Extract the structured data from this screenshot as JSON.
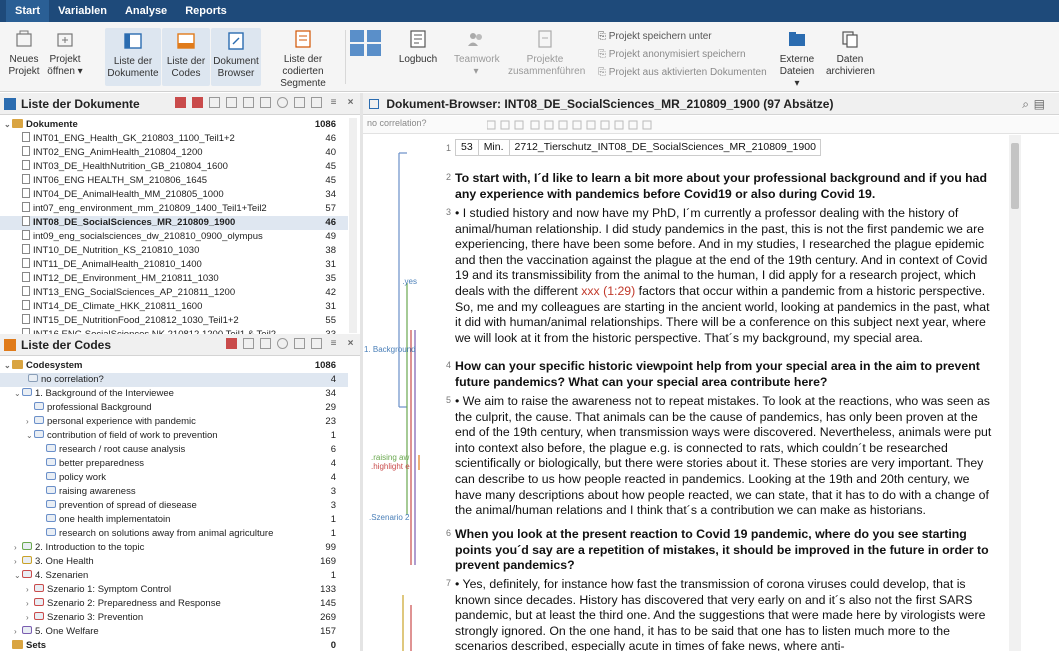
{
  "menu": [
    "Start",
    "Variablen",
    "Analyse",
    "Reports"
  ],
  "ribbon": {
    "buttons": [
      {
        "label": "Neues\nProjekt"
      },
      {
        "label": "Projekt\nöffnen ▾"
      },
      {
        "label": "Liste der\nDokumente"
      },
      {
        "label": "Liste der\nCodes"
      },
      {
        "label": "Dokument\nBrowser"
      },
      {
        "label": "Liste der codierten\nSegmente"
      },
      {
        "label": "Logbuch"
      },
      {
        "label": "Teamwork\n▾"
      },
      {
        "label": "Projekte\nzusammenführen"
      },
      {
        "label": "Externe\nDateien ▾"
      },
      {
        "label": "Daten\narchivieren"
      }
    ],
    "small_items": [
      "Projekt speichern unter",
      "Projekt anonymisiert speichern",
      "Projekt aus aktivierten Dokumenten"
    ]
  },
  "documents": {
    "title": "Liste der Dokumente",
    "root": {
      "label": "Dokumente",
      "count": "1086"
    },
    "items": [
      {
        "label": "INT01_ENG_Health_GK_210803_1100_Teil1+2",
        "count": "46"
      },
      {
        "label": "INT02_ENG_AnimHealth_210804_1200",
        "count": "40"
      },
      {
        "label": "INT03_DE_HealthNutrition_GB_210804_1600",
        "count": "45"
      },
      {
        "label": "INT06_ENG HEALTH_SM_210806_1645",
        "count": "45"
      },
      {
        "label": "INT04_DE_AnimalHealth_MM_210805_1000",
        "count": "34"
      },
      {
        "label": "int07_eng_environment_mm_210809_1400_Teil1+Teil2",
        "count": "57"
      },
      {
        "label": "INT08_DE_SocialSciences_MR_210809_1900",
        "count": "46"
      },
      {
        "label": "int09_eng_socialsciences_dw_210810_0900_olympus",
        "count": "49"
      },
      {
        "label": "INT10_DE_Nutrition_KS_210810_1030",
        "count": "38"
      },
      {
        "label": "INT11_DE_AnimalHealth_210810_1400",
        "count": "31"
      },
      {
        "label": "INT12_DE_Environment_HM_210811_1030",
        "count": "35"
      },
      {
        "label": "INT13_ENG_SocialSciences_AP_210811_1200",
        "count": "42"
      },
      {
        "label": "INT14_DE_Climate_HKK_210811_1600",
        "count": "31"
      },
      {
        "label": "INT15_DE_NutritionFood_210812_1030_Teil1+2",
        "count": "55"
      },
      {
        "label": "INT16 ENG SocialSciences NK 210812 1200 Teil1 & Teil2",
        "count": "33"
      }
    ]
  },
  "codes": {
    "title": "Liste der Codes",
    "root": {
      "label": "Codesystem",
      "count": "1086"
    },
    "items": [
      {
        "label": "no correlation?",
        "count": "4"
      },
      {
        "label": "1. Background of the Interviewee",
        "count": "34"
      },
      {
        "label": "professional Background",
        "count": "29"
      },
      {
        "label": "personal experience with pandemic",
        "count": "23"
      },
      {
        "label": "contribution of field of work to prevention",
        "count": "1"
      },
      {
        "label": "research / root cause analysis",
        "count": "6"
      },
      {
        "label": "better preparedness",
        "count": "4"
      },
      {
        "label": "policy work",
        "count": "4"
      },
      {
        "label": "raising awareness",
        "count": "3"
      },
      {
        "label": "prevention of spread of diesease",
        "count": "3"
      },
      {
        "label": "one health implementatoin",
        "count": "1"
      },
      {
        "label": "research on solutions away from animal agriculture",
        "count": "1"
      },
      {
        "label": "2. Introduction to the topic",
        "count": "99"
      },
      {
        "label": "3. One Health",
        "count": "169"
      },
      {
        "label": "4. Szenarien",
        "count": "1"
      },
      {
        "label": "Szenario 1: Symptom Control",
        "count": "133"
      },
      {
        "label": "Szenario 2: Preparedness and Response",
        "count": "145"
      },
      {
        "label": "Szenario 3: Prevention",
        "count": "269"
      },
      {
        "label": "5. One Welfare",
        "count": "157"
      },
      {
        "label": "Sets",
        "count": "0"
      }
    ]
  },
  "browser": {
    "title": "Dokument-Browser: INT08_DE_SocialSciences_MR_210809_1900   (97 Absätze)",
    "code_select": "no correlation?",
    "header_row": {
      "num": "53",
      "unit": "Min.",
      "name": "2712_Tierschutz_INT08_DE_SocialSciences_MR_210809_1900"
    },
    "gutter_labels": [
      ".yes",
      "1. Background",
      ".raising aw",
      ".highlight e",
      ".Szenario 2"
    ],
    "paragraphs": [
      {
        "num": "1"
      },
      {
        "num": "2",
        "text": "To start with, I´d like to learn a bit more about your professional background and if you had any experience with pandemics before Covid19 or also during Covid 19."
      },
      {
        "num": "3",
        "text_a": "• I studied history and now have my PhD, I´m currently a professor dealing with the history of animal/human relationship. I did study pandemics in the past, this is not the first pandemic we are experiencing, there have been some before. And in my studies, I researched the plague epidemic and then the vaccination against the plague at the end of the 19th century. And in context of Covid 19 and its transmissibility from the animal to the human, I did apply for a research project, which deals with the different ",
        "text_red": "xxx (1:29)",
        "text_b": " factors that occur within a pandemic from a historic perspective. So, me and my colleagues are starting in the ancient world, looking at pandemics in the past, what it did with human/animal relationships. There will be a conference on this subject next year, where we will look at it from the historic perspective. That´s my background, my special area."
      },
      {
        "num": "4",
        "text": "How can your specific historic viewpoint help from your special area in the aim to prevent future pandemics? What can your special area contribute here?"
      },
      {
        "num": "5",
        "text": "• We aim to raise the awareness not to repeat mistakes. To look at the reactions, who was seen as the culprit, the cause. That animals can be the cause of pandemics, has only been proven at the end of the 19th century, when transmission ways were discovered. Nevertheless, animals were put into context also before, the plague e.g. is connected to rats, which couldn´t be researched scientifically or biologically, but there were stories about it. These stories are very important. They can describe to us how people reacted in pandemics. Looking at the 19th and 20th century, we have many descriptions about how people reacted, we can state, that it has to do with a change of the animal/human relations and I think that´s a contribution we can make as historians."
      },
      {
        "num": "6",
        "text": "When you look at the present reaction to Covid 19 pandemic, where do you see starting points you´d say are a repetition of mistakes, it should be improved in the future in order to prevent pandemics?"
      },
      {
        "num": "7",
        "text": "• Yes, definitely, for instance how fast the transmission of corona viruses could develop, that is known since decades. History has discovered that very early on and it´s also not the first SARS pandemic, but at least the third one. And the suggestions that were made here by virologists were strongly ignored. On the one hand, it has to be said that one has to listen much more to the scenarios described, especially acute in times of fake news, where anti-"
      }
    ]
  },
  "colors": {
    "menubar": "#1e4a7a",
    "ribbon_bg": "#f5f5f5",
    "selection": "#dfe7f1",
    "accent_red": "#c0392b"
  }
}
